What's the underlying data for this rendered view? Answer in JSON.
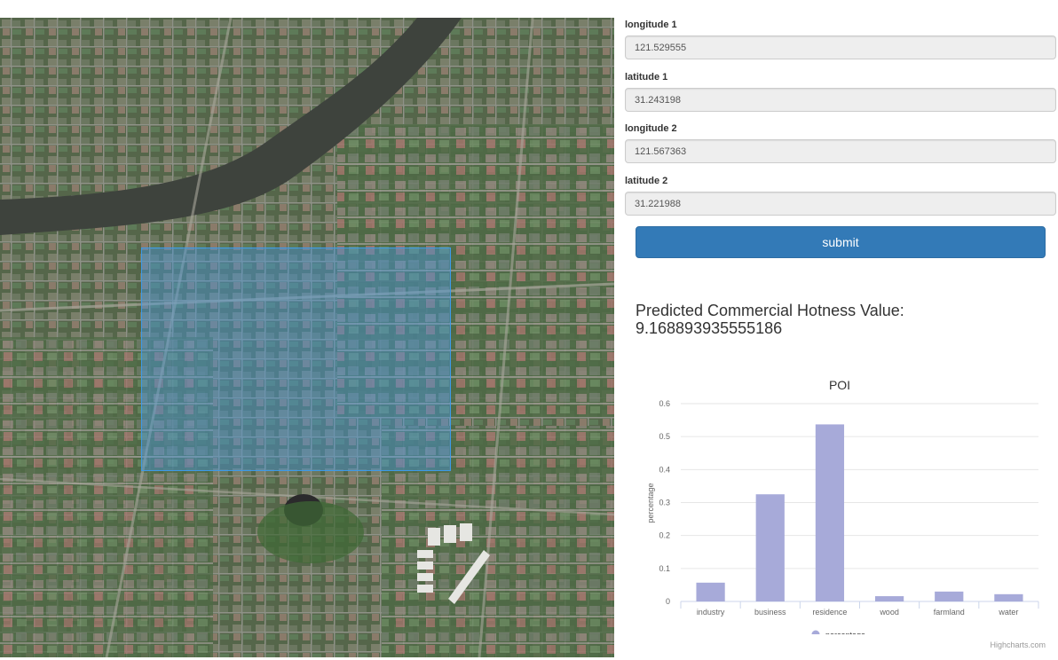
{
  "form": {
    "fields": [
      {
        "label": "longitude 1",
        "value": "121.529555"
      },
      {
        "label": "latitude 1",
        "value": "31.243198"
      },
      {
        "label": "longitude 2",
        "value": "121.567363"
      },
      {
        "label": "latitude 2",
        "value": "31.221988"
      }
    ],
    "submit_label": "submit"
  },
  "result": {
    "label": "Predicted Commercial Hotness Value:",
    "value": "9.168893935555186"
  },
  "chart_data": {
    "type": "bar",
    "title": "POI",
    "xlabel": "",
    "ylabel": "percentage",
    "categories": [
      "industry",
      "business",
      "residence",
      "wood",
      "farmland",
      "water"
    ],
    "series": [
      {
        "name": "percentage",
        "values": [
          0.057,
          0.325,
          0.537,
          0.016,
          0.03,
          0.022
        ]
      }
    ],
    "ylim": [
      0,
      0.6
    ],
    "yticks": [
      0,
      0.1,
      0.2,
      0.3,
      0.4,
      0.5,
      0.6
    ],
    "grid": true,
    "legend": "bottom-center",
    "bar_color": "#a7aad9",
    "credits": "Highcharts.com"
  },
  "map": {
    "water_color": "#3e433d",
    "selection_color": "#4696dc"
  }
}
